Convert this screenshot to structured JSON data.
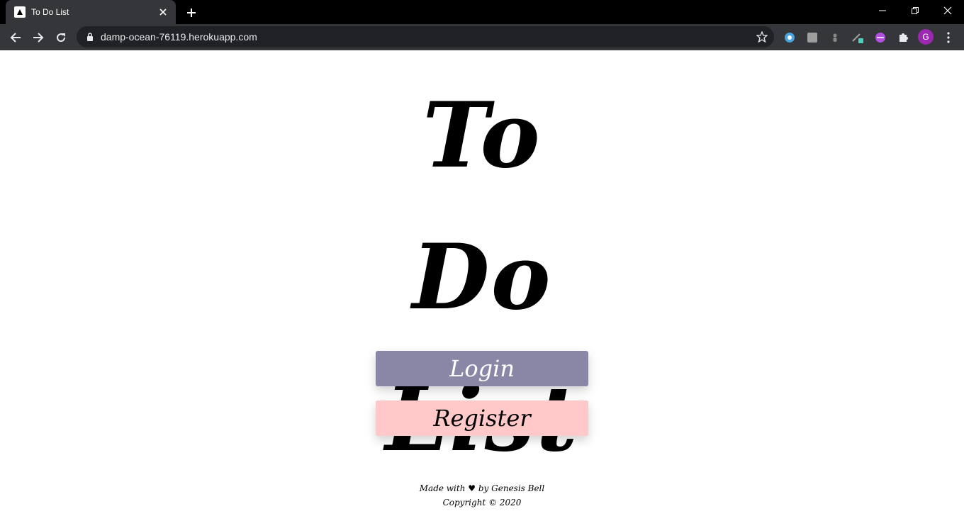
{
  "browser": {
    "tab_title": "To Do List",
    "url": "damp-ocean-76119.herokuapp.com",
    "profile_initial": "G"
  },
  "page": {
    "heading_line1": "To Do",
    "heading_line2": "List",
    "login_label": "Login",
    "register_label": "Register",
    "footer_made_prefix": "Made with",
    "footer_made_suffix": "by Genesis Bell",
    "footer_copyright": "Copyright © 2020"
  },
  "colors": {
    "login_bg": "#8a87a6",
    "register_bg": "#ffc8c9",
    "chrome_bg": "#35363a"
  }
}
